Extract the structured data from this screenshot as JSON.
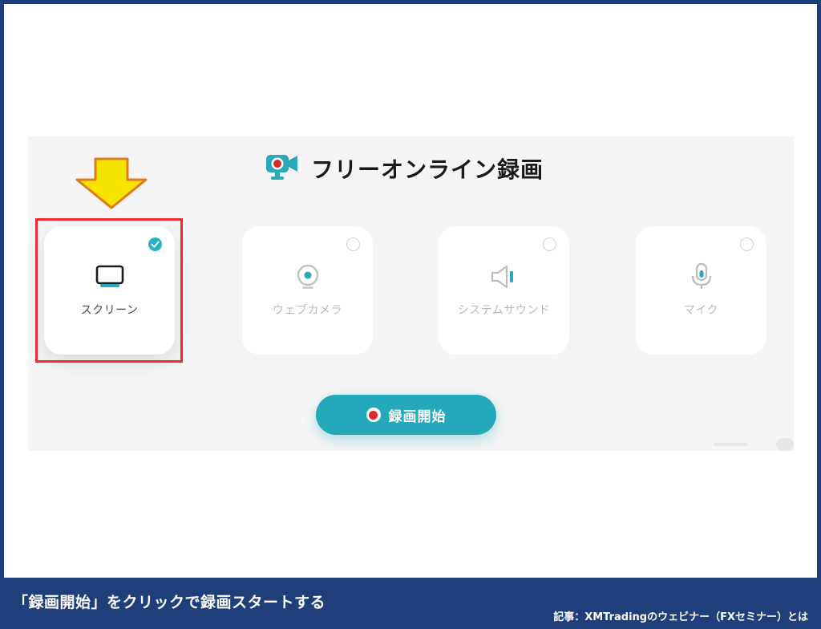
{
  "app": {
    "title": "フリーオンライン録画",
    "logo_icon": "camera-record-icon"
  },
  "options": [
    {
      "label": "スクリーン",
      "icon": "monitor-icon",
      "selected": true
    },
    {
      "label": "ウェブカメラ",
      "icon": "webcam-icon",
      "selected": false
    },
    {
      "label": "システムサウンド",
      "icon": "speaker-icon",
      "selected": false
    },
    {
      "label": "マイク",
      "icon": "microphone-icon",
      "selected": false
    }
  ],
  "start_button": {
    "label": "録画開始"
  },
  "annotation": {
    "arrow_icon": "arrow-down-icon",
    "arrow_color": "#f5e400",
    "highlight_color": "#ee2a2a"
  },
  "caption": {
    "main": "「録画開始」をクリックで録画スタートする",
    "source": "記事：XMTradingのウェビナー（FXセミナー）とは"
  },
  "colors": {
    "accent": "#24a9ba",
    "frame": "#1f3f7a",
    "record_dot": "#d42b2b"
  }
}
